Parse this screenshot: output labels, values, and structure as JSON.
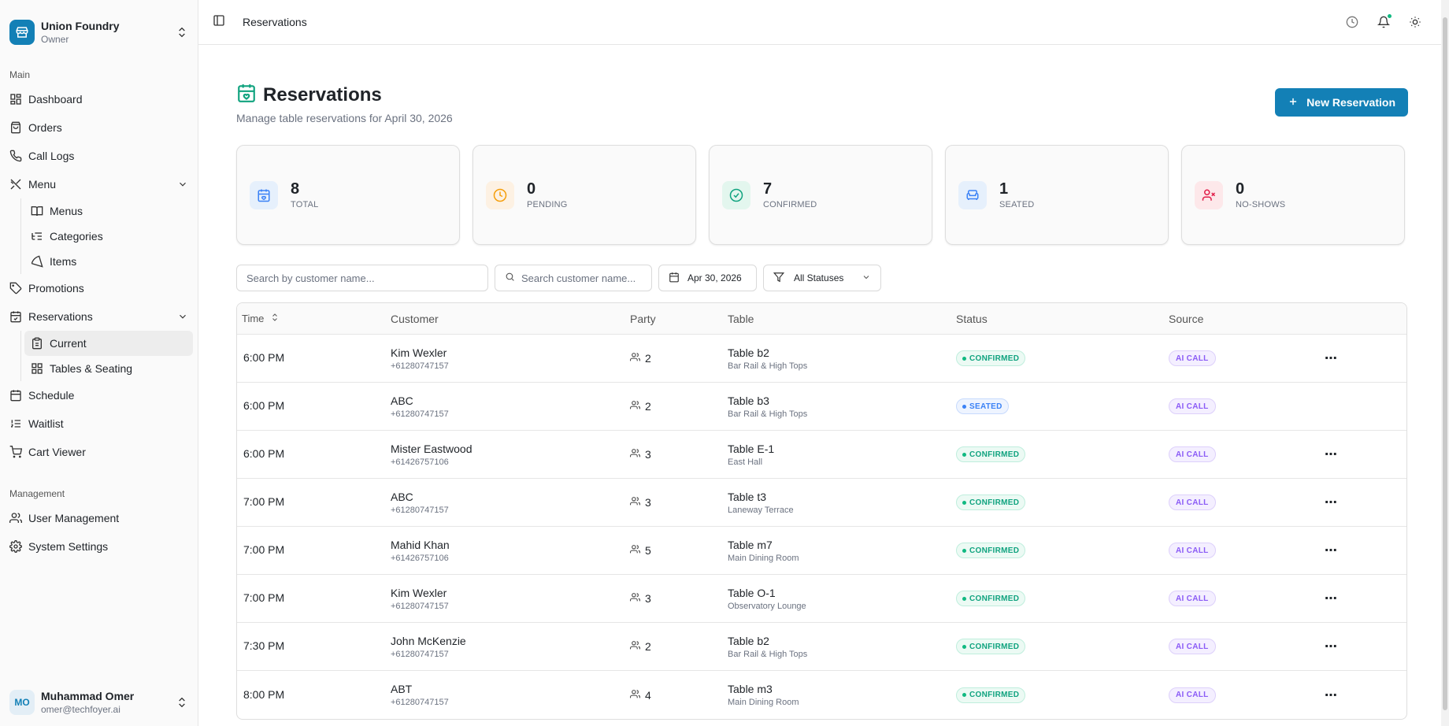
{
  "org": {
    "name": "Union Foundry",
    "role": "Owner"
  },
  "sidebar": {
    "main_label": "Main",
    "management_label": "Management",
    "items": {
      "dashboard": "Dashboard",
      "orders": "Orders",
      "call_logs": "Call Logs",
      "menu": "Menu",
      "menus": "Menus",
      "categories": "Categories",
      "items": "Items",
      "promotions": "Promotions",
      "reservations": "Reservations",
      "current": "Current",
      "tables_seating": "Tables & Seating",
      "schedule": "Schedule",
      "waitlist": "Waitlist",
      "cart_viewer": "Cart Viewer",
      "user_management": "User Management",
      "system_settings": "System Settings"
    }
  },
  "user": {
    "initials": "MO",
    "name": "Muhammad Omer",
    "email": "omer@techfoyer.ai"
  },
  "topbar": {
    "breadcrumb": "Reservations"
  },
  "page": {
    "title": "Reservations",
    "subtitle": "Manage table reservations for April 30, 2026",
    "new_button": "New Reservation"
  },
  "stats": [
    {
      "value": "8",
      "label": "TOTAL"
    },
    {
      "value": "0",
      "label": "PENDING"
    },
    {
      "value": "7",
      "label": "CONFIRMED"
    },
    {
      "value": "1",
      "label": "SEATED"
    },
    {
      "value": "0",
      "label": "NO-SHOWS"
    }
  ],
  "filters": {
    "search1_placeholder": "Search by customer name...",
    "search2_placeholder": "Search customer name...",
    "date": "Apr 30, 2026",
    "status": "All Statuses"
  },
  "table": {
    "headers": {
      "time": "Time",
      "customer": "Customer",
      "party": "Party",
      "table": "Table",
      "status": "Status",
      "source": "Source"
    },
    "rows": [
      {
        "time": "6:00 PM",
        "name": "Kim Wexler",
        "phone": "+61280747157",
        "party": "2",
        "table": "Table b2",
        "area": "Bar Rail & High Tops",
        "status": "CONFIRMED",
        "source": "AI CALL"
      },
      {
        "time": "6:00 PM",
        "name": "ABC",
        "phone": "+61280747157",
        "party": "2",
        "table": "Table b3",
        "area": "Bar Rail & High Tops",
        "status": "SEATED",
        "source": "AI CALL"
      },
      {
        "time": "6:00 PM",
        "name": "Mister Eastwood",
        "phone": "+61426757106",
        "party": "3",
        "table": "Table E-1",
        "area": "East Hall",
        "status": "CONFIRMED",
        "source": "AI CALL"
      },
      {
        "time": "7:00 PM",
        "name": "ABC",
        "phone": "+61280747157",
        "party": "3",
        "table": "Table t3",
        "area": "Laneway Terrace",
        "status": "CONFIRMED",
        "source": "AI CALL"
      },
      {
        "time": "7:00 PM",
        "name": "Mahid Khan",
        "phone": "+61426757106",
        "party": "5",
        "table": "Table m7",
        "area": "Main Dining Room",
        "status": "CONFIRMED",
        "source": "AI CALL"
      },
      {
        "time": "7:00 PM",
        "name": "Kim Wexler",
        "phone": "+61280747157",
        "party": "3",
        "table": "Table O-1",
        "area": "Observatory Lounge",
        "status": "CONFIRMED",
        "source": "AI CALL"
      },
      {
        "time": "7:30 PM",
        "name": "John McKenzie",
        "phone": "+61280747157",
        "party": "2",
        "table": "Table b2",
        "area": "Bar Rail & High Tops",
        "status": "CONFIRMED",
        "source": "AI CALL"
      },
      {
        "time": "8:00 PM",
        "name": "ABT",
        "phone": "+61280747157",
        "party": "4",
        "table": "Table m3",
        "area": "Main Dining Room",
        "status": "CONFIRMED",
        "source": "AI CALL"
      }
    ]
  }
}
